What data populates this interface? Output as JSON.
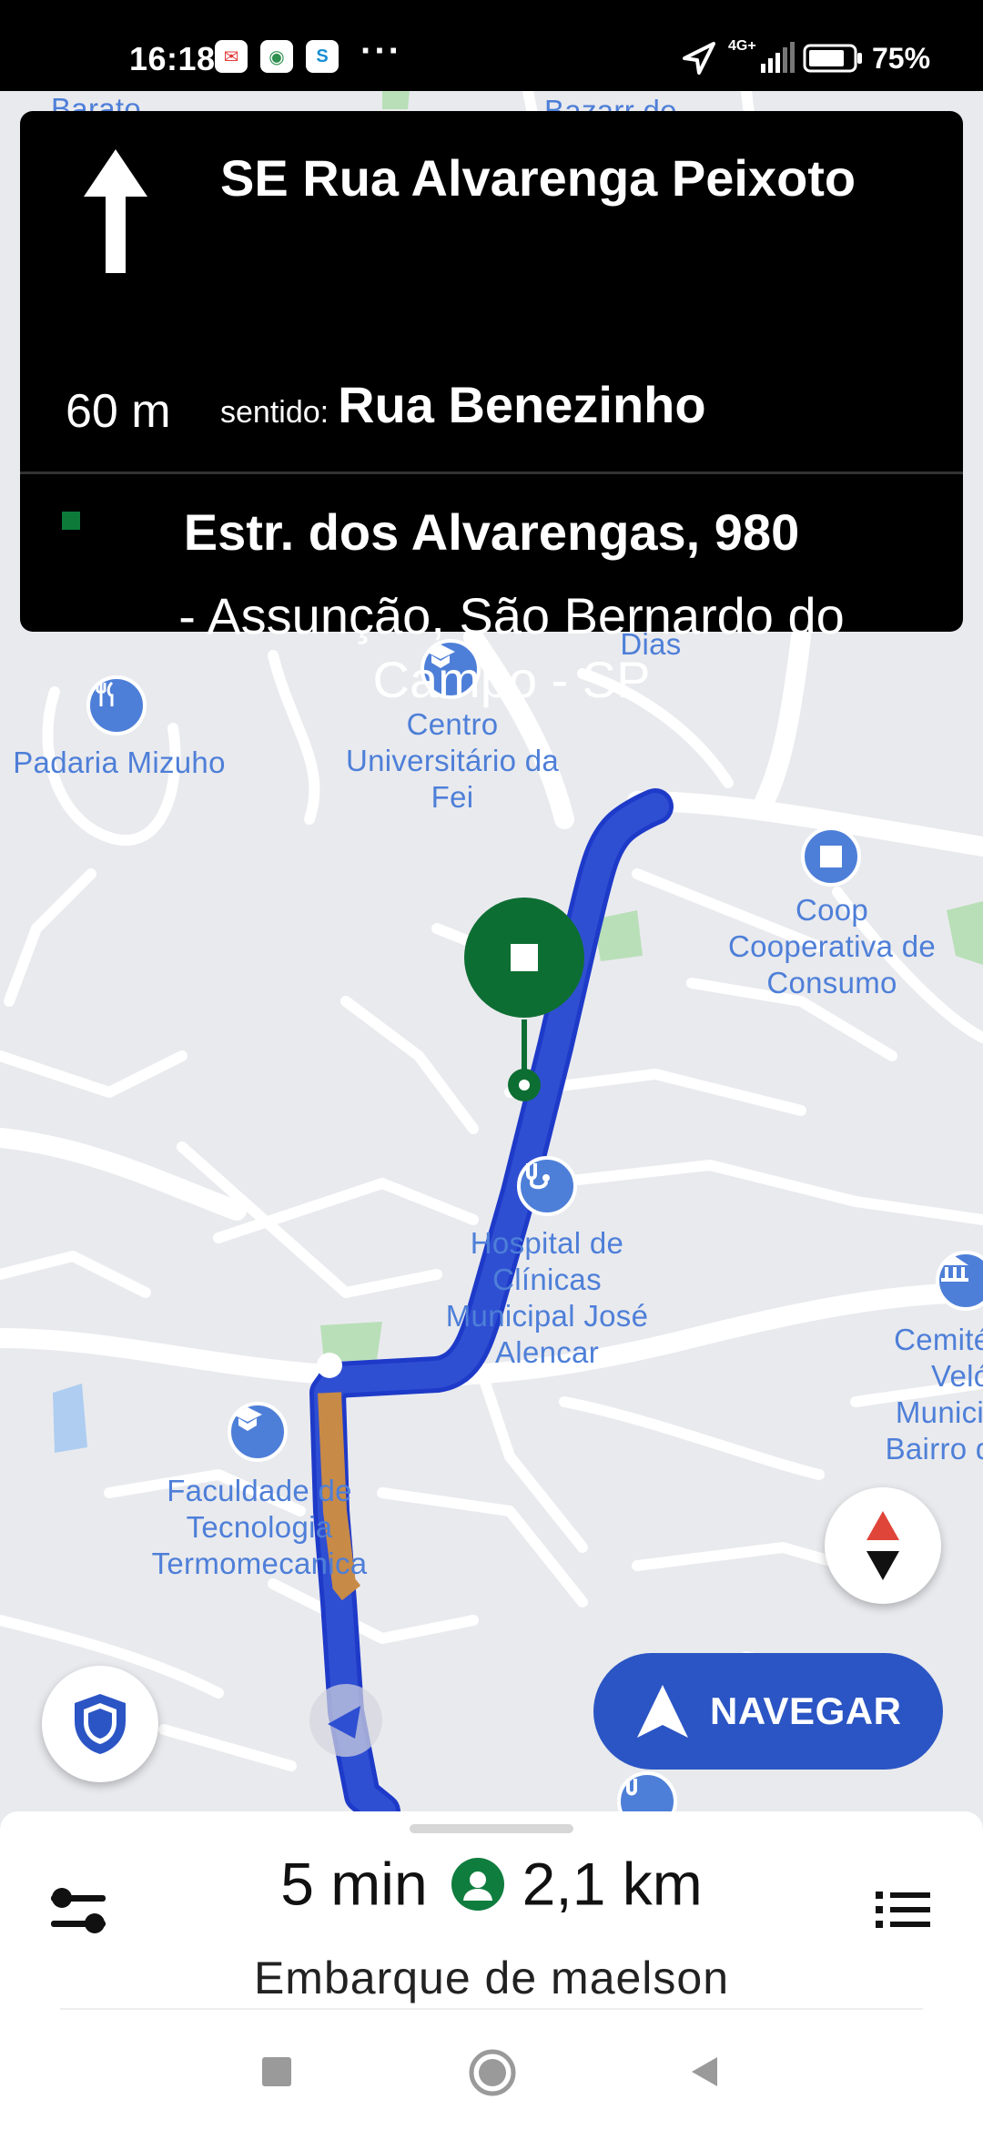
{
  "status_bar": {
    "time": "16:18",
    "network": "4G+",
    "battery": "75%",
    "more": "···"
  },
  "navigation": {
    "maneuver_icon": "arrow-up-icon",
    "distance": "60 m",
    "street": "SE Rua Alvarenga Peixoto",
    "sentido_label": "sentido:",
    "sentido_street": "Rua Benezinho",
    "destination_title": "Estr. dos Alvarengas, 980",
    "destination_subtitle": "- Assunção, São Bernardo do Campo - SP"
  },
  "map": {
    "top_labels": [
      "Barato",
      "Bazarr de"
    ],
    "pois": [
      {
        "label": "Padaria Mizuho",
        "icon": "restaurant-icon"
      },
      {
        "label": "Centro Universitário da Fei",
        "icon": "school-icon"
      },
      {
        "label": "Dias",
        "icon": ""
      },
      {
        "label": "Coop Cooperativa de Consumo",
        "icon": "shop-icon"
      },
      {
        "label": "Hospital de Clínicas Municipal José Alencar",
        "icon": "hospital-icon"
      },
      {
        "label": "Faculdade de Tecnologia Termomecanica",
        "icon": "school-icon"
      },
      {
        "label": "Cemitério Velório Municipal Bairro dos",
        "icon": "cemetery-icon"
      }
    ],
    "route_color": "#2f4fd2",
    "traffic_color": "#c88a47",
    "pickup_color": "#0d6e33"
  },
  "buttons": {
    "navegar": "NAVEGAR",
    "compass": "compass-icon",
    "safety": "shield-icon"
  },
  "bottom_sheet": {
    "eta": "5 min",
    "distance": "2,1 km",
    "subtitle": "Embarque de maelson",
    "left_icon": "preferences-icon",
    "right_icon": "list-icon"
  }
}
